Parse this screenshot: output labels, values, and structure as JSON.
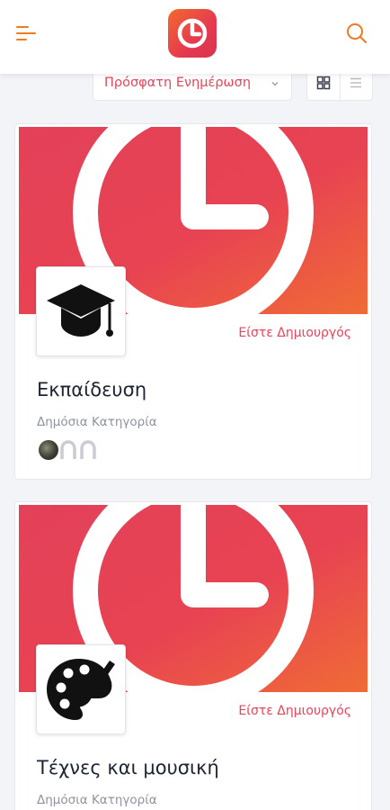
{
  "header": {
    "menu_icon": "hamburger-menu-icon",
    "logo_icon": "clock-logo-icon",
    "search_icon": "search-icon",
    "accent_color": "#f07a1e"
  },
  "toolbar": {
    "sort_value": "Πρόσφατη Ενημέρωση",
    "sort_color": "#e9445a",
    "view_modes": [
      "grid-view-icon",
      "list-view-icon"
    ]
  },
  "cards": [
    {
      "icon": "graduation-cap-icon",
      "badge": "Είστε Δημιουργός",
      "title": "Εκπαίδευση",
      "subtitle": "Δημόσια Κατηγορία",
      "members": [
        "photo-avatar",
        "placeholder-avatar",
        "placeholder-avatar"
      ]
    },
    {
      "icon": "palette-icon",
      "badge": "Είστε Δημιουργός",
      "title": "Τέχνες και μουσική",
      "subtitle": "Δημόσια Κατηγορία"
    }
  ]
}
